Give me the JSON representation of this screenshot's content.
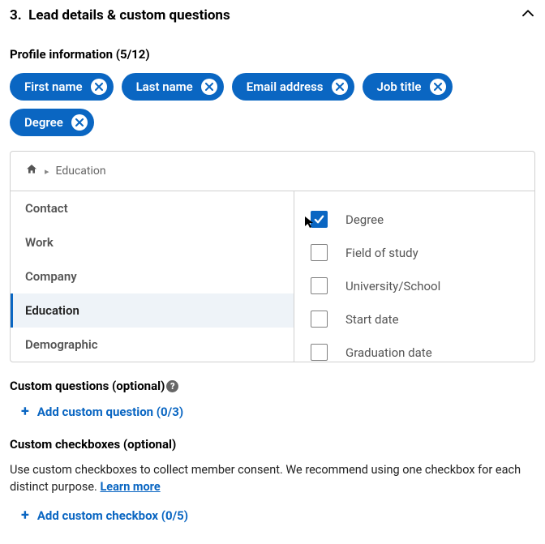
{
  "section": {
    "number": "3.",
    "title": "Lead details & custom questions"
  },
  "profile": {
    "heading": "Profile information (5/12)",
    "chips": [
      {
        "label": "First name"
      },
      {
        "label": "Last name"
      },
      {
        "label": "Email address"
      },
      {
        "label": "Job title"
      },
      {
        "label": "Degree"
      }
    ]
  },
  "picker": {
    "breadcrumb_current": "Education",
    "categories": [
      {
        "label": "Contact",
        "active": false
      },
      {
        "label": "Work",
        "active": false
      },
      {
        "label": "Company",
        "active": false
      },
      {
        "label": "Education",
        "active": true
      },
      {
        "label": "Demographic",
        "active": false
      }
    ],
    "fields": [
      {
        "label": "Degree",
        "checked": true
      },
      {
        "label": "Field of study",
        "checked": false
      },
      {
        "label": "University/School",
        "checked": false
      },
      {
        "label": "Start date",
        "checked": false
      },
      {
        "label": "Graduation date",
        "checked": false
      }
    ]
  },
  "custom_questions": {
    "heading": "Custom questions (optional)",
    "add_label": "Add custom question (0/3)"
  },
  "custom_checkboxes": {
    "heading": "Custom checkboxes (optional)",
    "description": "Use custom checkboxes to collect member consent. We recommend using one checkbox for each distinct purpose. ",
    "learn_more": "Learn more",
    "add_label": "Add custom checkbox (0/5)"
  }
}
